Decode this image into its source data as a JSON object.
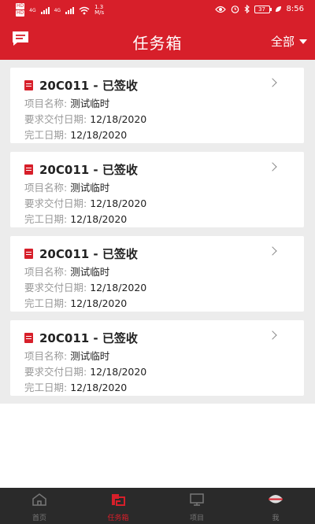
{
  "status_bar": {
    "hd_top": "HD",
    "hd_bottom": "HD",
    "net1": "4G",
    "net2": "4G",
    "speed_value": "1.3",
    "speed_unit": "M/s",
    "battery": "37",
    "time": "8:56"
  },
  "header": {
    "title": "任务箱",
    "filter_label": "全部",
    "accent": "#d71f2a"
  },
  "tasks": [
    {
      "title": "20C011 - 已签收",
      "project_label": "项目名称:",
      "project_value": "测试临时",
      "delivery_label": "要求交付日期:",
      "delivery_value": "12/18/2020",
      "completion_label": "完工日期:",
      "completion_value": "12/18/2020"
    },
    {
      "title": "20C011 - 已签收",
      "project_label": "项目名称:",
      "project_value": "测试临时",
      "delivery_label": "要求交付日期:",
      "delivery_value": "12/18/2020",
      "completion_label": "完工日期:",
      "completion_value": "12/18/2020"
    },
    {
      "title": "20C011 - 已签收",
      "project_label": "项目名称:",
      "project_value": "测试临时",
      "delivery_label": "要求交付日期:",
      "delivery_value": "12/18/2020",
      "completion_label": "完工日期:",
      "completion_value": "12/18/2020"
    },
    {
      "title": "20C011 - 已签收",
      "project_label": "项目名称:",
      "project_value": "测试临时",
      "delivery_label": "要求交付日期:",
      "delivery_value": "12/18/2020",
      "completion_label": "完工日期:",
      "completion_value": "12/18/2020"
    }
  ],
  "tabbar": {
    "items": [
      {
        "label": "首页",
        "icon": "home-icon",
        "active": false
      },
      {
        "label": "任务箱",
        "icon": "task-box-icon",
        "active": true
      },
      {
        "label": "项目",
        "icon": "project-icon",
        "active": false
      },
      {
        "label": "我",
        "icon": "profile-icon",
        "active": false
      }
    ]
  }
}
